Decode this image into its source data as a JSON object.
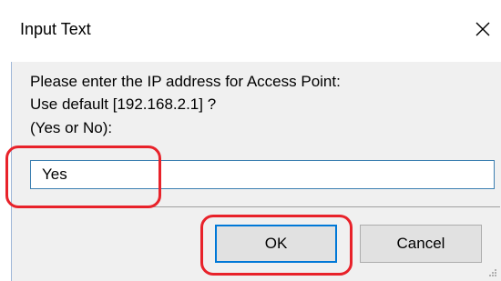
{
  "window": {
    "title": "Input Text",
    "close_icon": "close-icon",
    "close_glyph": "✕"
  },
  "prompt": {
    "line1": "Please enter the IP address for Access Point:",
    "line2": "Use default [192.168.2.1] ?",
    "line3": "(Yes or No):"
  },
  "input": {
    "value": "Yes"
  },
  "buttons": {
    "ok_label": "OK",
    "cancel_label": "Cancel"
  },
  "annotations": {
    "highlight_color": "#e8222a"
  },
  "colors": {
    "input_border": "#3c7fb1",
    "default_button_border": "#0078d7",
    "client_background": "#f0f0f0"
  }
}
